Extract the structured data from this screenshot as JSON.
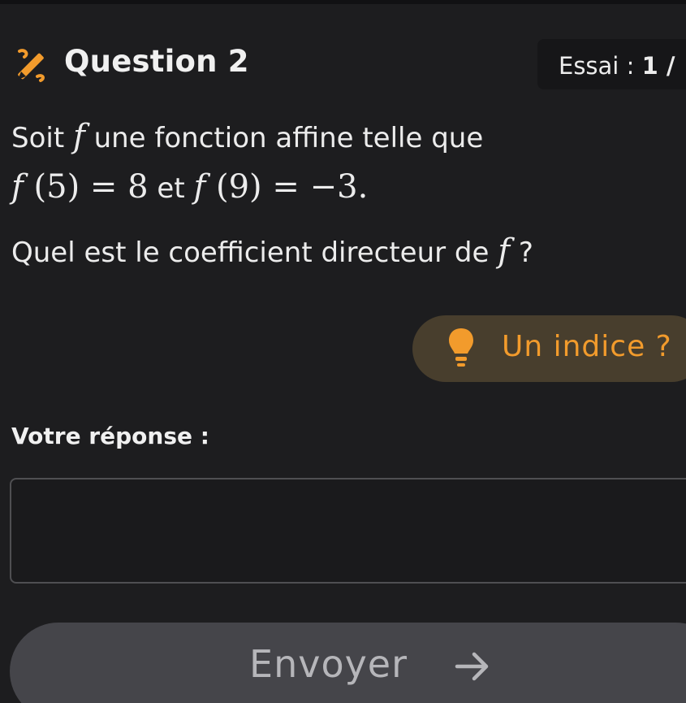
{
  "question": {
    "title": "Question 2",
    "icon": "pencil-ruler-icon",
    "attempt_label": "Essai : ",
    "attempt_value": "1 /"
  },
  "statement": {
    "line1_prefix": "Soit ",
    "func": "f",
    "line1_suffix": " une fonction affine telle que",
    "eq1_lhs": "f",
    "eq1_args": " (5) = 8",
    "conjunction": " et ",
    "eq2_lhs": "f",
    "eq2_args": " (9) = −3.",
    "question_prefix": "Quel est le coefficient directeur de ",
    "question_suffix": " ?"
  },
  "hint": {
    "label": "Un indice ?",
    "icon": "lightbulb-icon",
    "color": "#f29b2c"
  },
  "answer": {
    "label": "Votre réponse :",
    "value": "",
    "placeholder": ""
  },
  "submit": {
    "label": "Envoyer",
    "icon": "arrow-right-icon"
  },
  "colors": {
    "background": "#1d1d1f",
    "accent": "#f29b2c",
    "hint_background": "#483e2d",
    "button_background": "#45454a"
  }
}
